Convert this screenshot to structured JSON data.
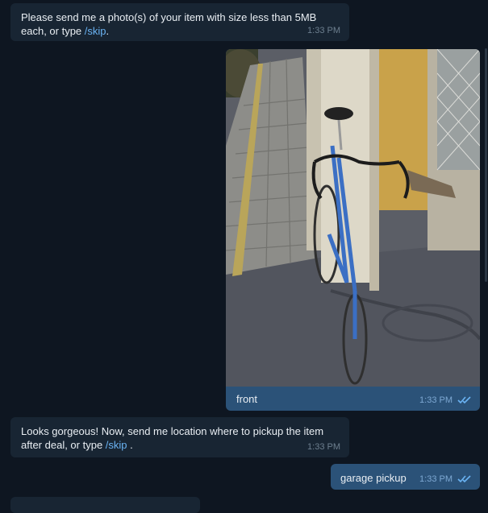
{
  "messages": [
    {
      "text_before": "Please send me a photo(s) of your item with size less than 5MB each, or type ",
      "link": "/skip",
      "text_after": ".",
      "time": "1:33 PM"
    },
    {
      "caption": "front",
      "time": "1:33 PM",
      "photo_icon": "bicycle-photo"
    },
    {
      "text_before": "Looks gorgeous! Now, send me location where to pickup the item after deal, or type ",
      "link": "/skip",
      "text_after": " .",
      "time": "1:33 PM"
    },
    {
      "text": "garage pickup",
      "time": "1:33 PM"
    }
  ],
  "colors": {
    "background": "#0e1621",
    "incoming": "#182533",
    "outgoing": "#2b5278",
    "link": "#6ab3f3"
  }
}
